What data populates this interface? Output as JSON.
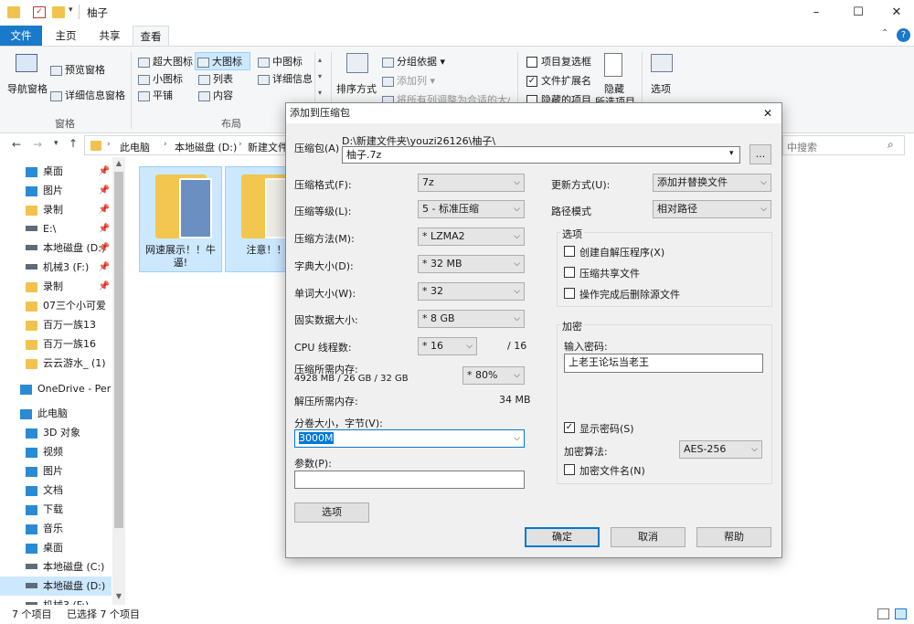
{
  "window": {
    "title": "柚子"
  },
  "tabs": [
    {
      "label": "文件"
    },
    {
      "label": "主页"
    },
    {
      "label": "共享"
    },
    {
      "label": "查看"
    }
  ],
  "ribbon": {
    "nav_pane": "导航窗格",
    "preview_pane": "预览窗格",
    "details_pane": "详细信息窗格",
    "pane_group": "窗格",
    "layout": [
      "超大图标",
      "大图标",
      "中图标",
      "小图标",
      "列表",
      "详细信息",
      "平铺",
      "内容"
    ],
    "layout_group": "布局",
    "sort": "排序方式",
    "group_by": "分组依据",
    "add_col": "添加列",
    "fit_cols": "将所有列调整为合适的大小",
    "item_checkbox": "项目复选框",
    "file_ext": "文件扩展名",
    "hidden_items": "隐藏的项目",
    "hide": "隐藏",
    "hide_sel": "所选项目",
    "options": "选项"
  },
  "address": {
    "path": [
      "此电脑",
      "本地磁盘 (D:)",
      "新建文件夹"
    ],
    "search_placeholder": "中搜索"
  },
  "nav": [
    {
      "label": "桌面",
      "icon": "desktop-icon",
      "pinned": true
    },
    {
      "label": "图片",
      "icon": "pictures-icon",
      "pinned": true
    },
    {
      "label": "录制",
      "icon": "folder-icon",
      "pinned": true
    },
    {
      "label": "E:\\",
      "icon": "drive-icon",
      "pinned": true
    },
    {
      "label": "本地磁盘 (D:)",
      "icon": "drive-icon",
      "pinned": true
    },
    {
      "label": "机械3 (F:)",
      "icon": "drive-icon",
      "pinned": true
    },
    {
      "label": "录制",
      "icon": "folder-icon",
      "pinned": true
    },
    {
      "label": "07三个小可爱",
      "icon": "folder-icon",
      "pinned": false
    },
    {
      "label": "百万一族13",
      "icon": "folder-icon",
      "pinned": false
    },
    {
      "label": "百万一族16",
      "icon": "folder-icon",
      "pinned": false
    },
    {
      "label": "云云游水_ (1)",
      "icon": "folder-icon",
      "pinned": false
    },
    {
      "label": "OneDrive - Personal",
      "icon": "cloud-icon",
      "pinned": false
    },
    {
      "label": "此电脑",
      "icon": "pc-icon",
      "pinned": false
    },
    {
      "label": "3D 对象",
      "icon": "3d-icon",
      "pinned": false
    },
    {
      "label": "视频",
      "icon": "video-icon",
      "pinned": false
    },
    {
      "label": "图片",
      "icon": "pictures-icon",
      "pinned": false
    },
    {
      "label": "文档",
      "icon": "docs-icon",
      "pinned": false
    },
    {
      "label": "下载",
      "icon": "download-icon",
      "pinned": false
    },
    {
      "label": "音乐",
      "icon": "music-icon",
      "pinned": false
    },
    {
      "label": "桌面",
      "icon": "desktop-icon",
      "pinned": false
    },
    {
      "label": "本地磁盘 (C:)",
      "icon": "drive-icon",
      "pinned": false
    },
    {
      "label": "本地磁盘 (D:)",
      "icon": "drive-icon",
      "pinned": false
    },
    {
      "label": "机械3 (F:)",
      "icon": "drive-icon",
      "pinned": false
    }
  ],
  "files": [
    {
      "name": "网速展示！！牛逼!"
    },
    {
      "name": "注意！！"
    }
  ],
  "status": {
    "count": "7 个项目",
    "selected": "已选择 7 个项目"
  },
  "dialog": {
    "title": "添加到压缩包",
    "archive_label": "压缩包(A)",
    "archive_dir": "D:\\新建文件夹\\youzi26126\\柚子\\",
    "archive_name": "柚子.7z",
    "browse": "...",
    "format_label": "压缩格式(F):",
    "format": "7z",
    "level_label": "压缩等级(L):",
    "level": "5 - 标准压缩",
    "method_label": "压缩方法(M):",
    "method": "* LZMA2",
    "dict_label": "字典大小(D):",
    "dict": "* 32 MB",
    "word_label": "单词大小(W):",
    "word": "* 32",
    "solid_label": "固实数据大小:",
    "solid": "* 8 GB",
    "cpu_label": "CPU 线程数:",
    "cpu": "* 16",
    "cpu_total": "/ 16",
    "mem_label": "压缩所需内存:",
    "mem_detail": "4928 MB / 26 GB / 32 GB",
    "mem_pct": "* 80%",
    "unmem_label": "解压所需内存:",
    "unmem": "34 MB",
    "split_label": "分卷大小，字节(V):",
    "split": "3000M",
    "params_label": "参数(P):",
    "params": "",
    "options_btn": "选项",
    "update_label": "更新方式(U):",
    "update": "添加并替换文件",
    "path_label": "路径模式",
    "path": "相对路径",
    "options_group": "选项",
    "sfx": "创建自解压程序(X)",
    "shared": "压缩共享文件",
    "delete": "操作完成后删除源文件",
    "enc_group": "加密",
    "pw_label": "输入密码:",
    "pw": "上老王论坛当老王",
    "show_pw": "显示密码(S)",
    "enc_method_label": "加密算法:",
    "enc_method": "AES-256",
    "enc_names": "加密文件名(N)",
    "ok": "确定",
    "cancel": "取消",
    "help": "帮助"
  },
  "colors": {
    "accent": "#1979ca"
  }
}
